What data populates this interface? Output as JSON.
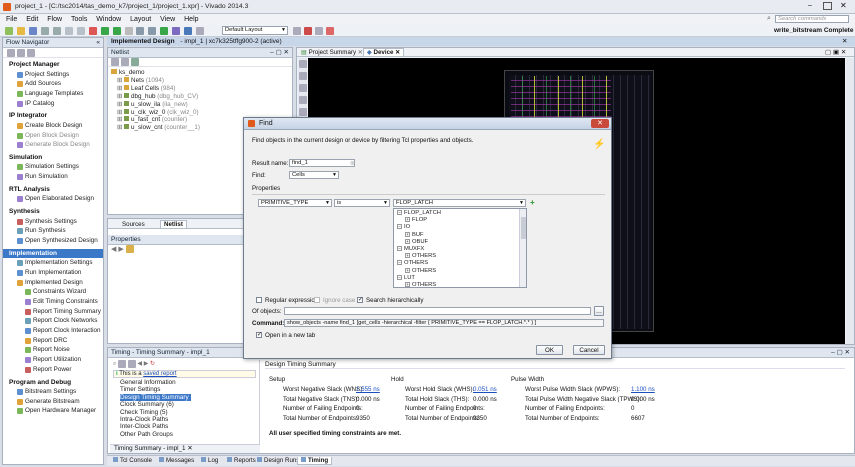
{
  "window": {
    "title": "project_1 - [C:/tsc2014/tas_demo_k7/project_1/project_1.xpr] - Vivado 2014.3",
    "status": "write_bitstream Complete"
  },
  "menu": [
    "File",
    "Edit",
    "Flow",
    "Tools",
    "Window",
    "Layout",
    "View",
    "Help"
  ],
  "toolbar": {
    "layout_select": "Default Layout",
    "search_placeholder": "Search commands"
  },
  "flow_nav": {
    "title": "Flow Navigator",
    "sections": [
      {
        "name": "Project Manager",
        "items": [
          "Project Settings",
          "Add Sources",
          "Language Templates",
          "IP Catalog"
        ]
      },
      {
        "name": "IP Integrator",
        "items": [
          "Create Block Design",
          "Open Block Design",
          "Generate Block Design"
        ]
      },
      {
        "name": "Simulation",
        "items": [
          "Simulation Settings",
          "Run Simulation"
        ]
      },
      {
        "name": "RTL Analysis",
        "items": [
          "Open Elaborated Design"
        ]
      },
      {
        "name": "Synthesis",
        "items": [
          "Synthesis Settings",
          "Run Synthesis",
          "Open Synthesized Design"
        ]
      },
      {
        "name": "Implementation",
        "items": [
          "Implementation Settings",
          "Run Implementation",
          "Implemented Design",
          "Constraints Wizard",
          "Edit Timing Constraints",
          "Report Timing Summary",
          "Report Clock Networks",
          "Report Clock Interaction",
          "Report DRC",
          "Report Noise",
          "Report Utilization",
          "Report Power"
        ]
      },
      {
        "name": "Program and Debug",
        "items": [
          "Bitstream Settings",
          "Generate Bitstream",
          "Open Hardware Manager"
        ]
      }
    ]
  },
  "design_header": {
    "title": "Implemented Design",
    "sub": "- impl_1 | xc7k325tffg900-2 (active)"
  },
  "netlist": {
    "title": "Netlist",
    "root": "ks_demo",
    "items": [
      {
        "name": "Nets",
        "count": "(1094)"
      },
      {
        "name": "Leaf Cells",
        "count": "(984)"
      },
      {
        "name": "dbg_hub",
        "count": "(dbg_hub_CV)"
      },
      {
        "name": "u_slow_ila",
        "count": "(ila_new)"
      },
      {
        "name": "u_clk_wiz_0",
        "count": "(clk_wiz_0)"
      },
      {
        "name": "u_fast_cnt",
        "count": "(counter)"
      },
      {
        "name": "u_slow_cnt",
        "count": "(counter__1)"
      }
    ],
    "tabs": [
      "Sources",
      "Netlist"
    ],
    "properties_title": "Properties"
  },
  "main_tabs": [
    "Project Summary",
    "Device"
  ],
  "find": {
    "title": "Find",
    "description": "Find objects in the current design or device by filtering Tcl properties and objects.",
    "result_name_label": "Result name:",
    "result_name": "find_1",
    "find_label": "Find:",
    "find_value": "Cells",
    "properties_label": "Properties",
    "property": "PRIMITIVE_TYPE",
    "operator": "is",
    "value": "FLOP_LATCH",
    "tree": [
      {
        "t": "FLOP_LATCH",
        "lvl": 0,
        "exp": "−"
      },
      {
        "t": "FLOP",
        "lvl": 1,
        "exp": "+"
      },
      {
        "t": "IO",
        "lvl": 0,
        "exp": "−"
      },
      {
        "t": "BUF",
        "lvl": 1,
        "exp": "+"
      },
      {
        "t": "OBUF",
        "lvl": 1,
        "exp": "+"
      },
      {
        "t": "MUXFX",
        "lvl": 0,
        "exp": "−"
      },
      {
        "t": "OTHERS",
        "lvl": 1,
        "exp": "+"
      },
      {
        "t": "OTHERS",
        "lvl": 0,
        "exp": "−"
      },
      {
        "t": "OTHERS",
        "lvl": 1,
        "exp": "+"
      },
      {
        "t": "LUT",
        "lvl": 0,
        "exp": "−"
      },
      {
        "t": "OTHERS",
        "lvl": 1,
        "exp": "+"
      },
      {
        "t": "CLK",
        "lvl": 0,
        "exp": "−"
      }
    ],
    "regex_label": "Regular expression",
    "ignore_case_label": "Ignore case",
    "search_hier_label": "Search hierarchically",
    "of_objects_label": "Of objects:",
    "command_label": "Command:",
    "command": "show_objects -name find_1 [get_cells -hierarchical -filter { PRIMITIVE_TYPE == FLOP_LATCH.*.* } ]",
    "open_new_tab_label": "Open in a new tab",
    "ok": "OK",
    "cancel": "Cancel"
  },
  "timing": {
    "title": "Timing - Timing Summary - impl_1",
    "notice_prefix": "This is a",
    "notice_link": "saved report",
    "tree": [
      "General Information",
      "Timer Settings",
      "Design Timing Summary",
      "Clock Summary (6)",
      "Check Timing (5)",
      "Intra-Clock Paths",
      "Inter-Clock Paths",
      "Other Path Groups"
    ],
    "summary_title": "Design Timing Summary",
    "setup_label": "Setup",
    "hold_label": "Hold",
    "pw_label": "Pulse Width",
    "setup": [
      [
        "Worst Negative Slack (WNS):",
        "1.555 ns"
      ],
      [
        "Total Negative Slack (TNS):",
        "0.000 ns"
      ],
      [
        "Number of Failing Endpoints:",
        "0"
      ],
      [
        "Total Number of Endpoints:",
        "9350"
      ]
    ],
    "hold": [
      [
        "Worst Hold Slack (WHS):",
        "0.051 ns"
      ],
      [
        "Total Hold Slack (THS):",
        "0.000 ns"
      ],
      [
        "Number of Failing Endpoints:",
        "0"
      ],
      [
        "Total Number of Endpoints:",
        "9350"
      ]
    ],
    "pw": [
      [
        "Worst Pulse Width Slack (WPWS):",
        "1.100 ns"
      ],
      [
        "Total Pulse Width Negative Slack (TPWS):",
        "0.000 ns"
      ],
      [
        "Number of Failing Endpoints:",
        "0"
      ],
      [
        "Total Number of Endpoints:",
        "6607"
      ]
    ],
    "footer": "All user specified timing constraints are met.",
    "bottom_tab": "Timing Summary - impl_1"
  },
  "bottom_tabs": [
    "Tcl Console",
    "Messages",
    "Log",
    "Reports",
    "Design Runs",
    "Timing"
  ]
}
